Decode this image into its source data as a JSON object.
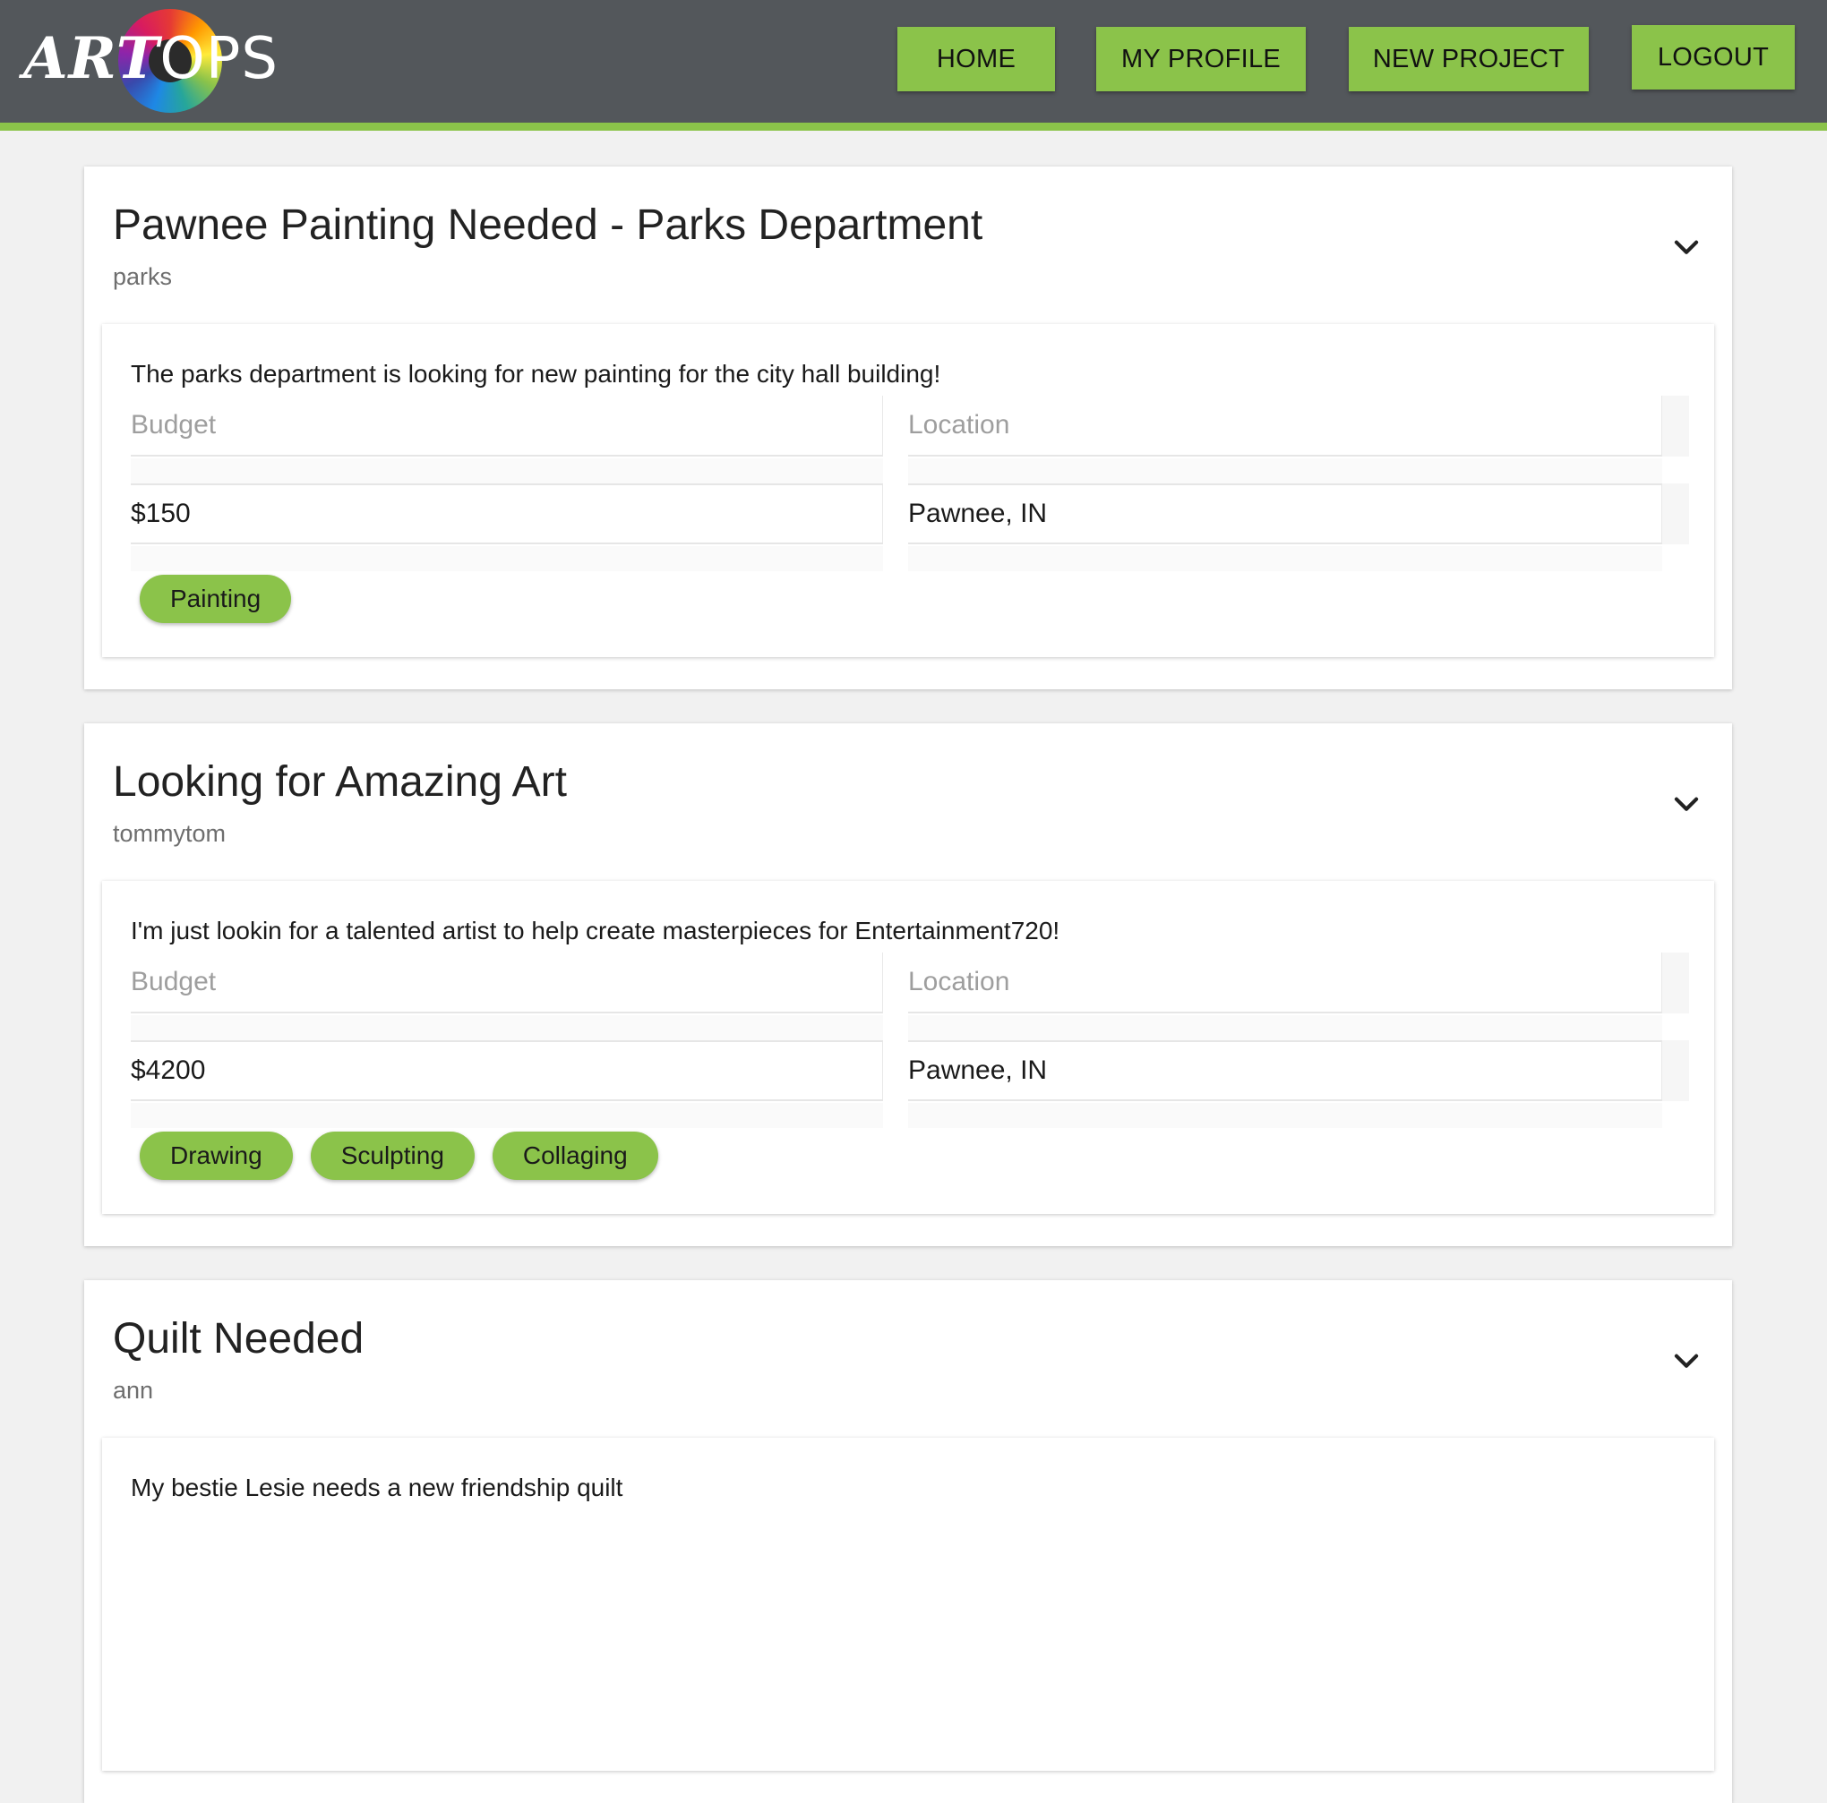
{
  "header": {
    "logo": {
      "art": "ART",
      "ops": "OPS"
    },
    "nav": {
      "home": "HOME",
      "profile": "MY PROFILE",
      "new_project": "NEW PROJECT",
      "logout": "LOGOUT"
    },
    "colors": {
      "bar": "#53575b",
      "accent": "#8bc34a"
    }
  },
  "field_labels": {
    "budget": "Budget",
    "location": "Location"
  },
  "projects": [
    {
      "title": "Pawnee Painting Needed - Parks Department",
      "owner": "parks",
      "description": "The parks department is looking for new painting for the city hall building!",
      "budget": "$150",
      "location": "Pawnee, IN",
      "tags": [
        "Painting"
      ]
    },
    {
      "title": "Looking for Amazing Art",
      "owner": "tommytom",
      "description": "I'm just lookin for a talented artist to help create masterpieces for Entertainment720!",
      "budget": "$4200",
      "location": "Pawnee, IN",
      "tags": [
        "Drawing",
        "Sculpting",
        "Collaging"
      ]
    },
    {
      "title": "Quilt Needed",
      "owner": "ann",
      "description": "My bestie Lesie needs a new friendship quilt"
    }
  ],
  "icons": {
    "expand": "chevron-down-icon",
    "logo": "color-wheel-icon"
  }
}
